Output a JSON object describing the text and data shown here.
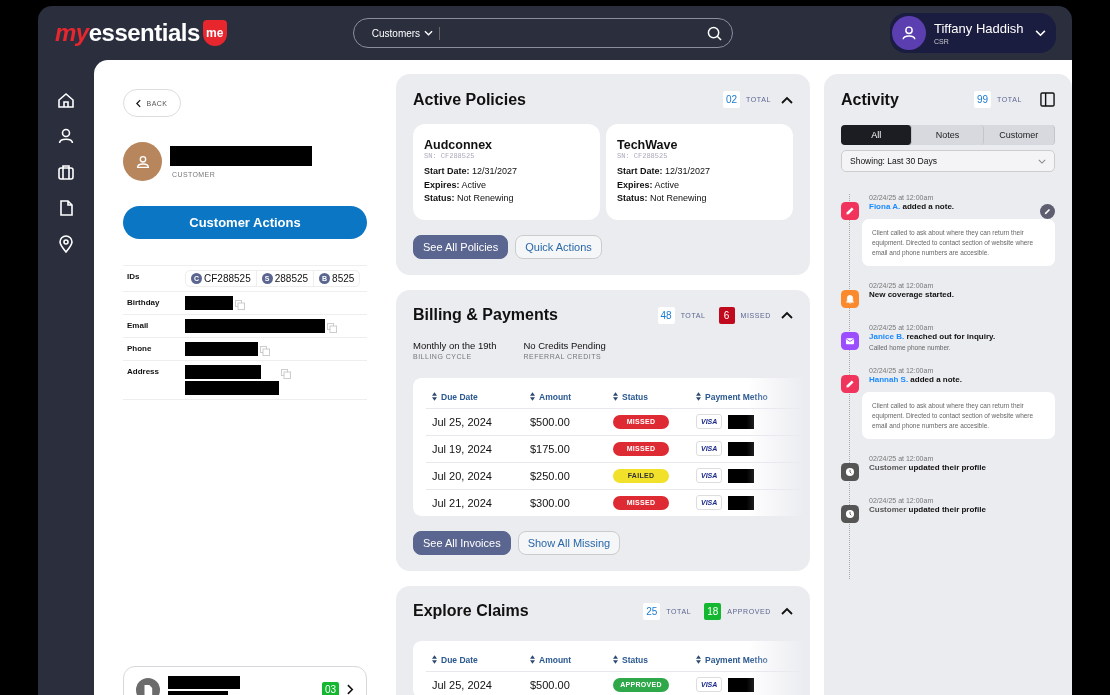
{
  "header": {
    "logo": {
      "first": "my",
      "second": "essentials",
      "badge": "me"
    },
    "search": {
      "scope": "Customers"
    },
    "user": {
      "name": "Tiffany Haddish",
      "role": "CSR"
    }
  },
  "nav": [
    {
      "kind": "home"
    },
    {
      "kind": "user"
    },
    {
      "kind": "briefcase"
    },
    {
      "kind": "file"
    },
    {
      "kind": "pin"
    }
  ],
  "customer": {
    "back": "BACK",
    "role": "CUSTOMER",
    "actions_button": "Customer Actions",
    "ids_label": "IDs",
    "ids": [
      {
        "icon": "C",
        "value": "CF288525"
      },
      {
        "icon": "S",
        "value": "288525"
      },
      {
        "icon": "B",
        "value": "8525"
      }
    ],
    "fields": [
      {
        "label": "Birthday"
      },
      {
        "label": "Email"
      },
      {
        "label": "Phone"
      },
      {
        "label": "Address"
      }
    ],
    "footer_card": {
      "count": "03"
    }
  },
  "policies": {
    "title": "Active Policies",
    "badges": [
      {
        "kind": "total",
        "count": "02",
        "label": "TOTAL"
      }
    ],
    "items": [
      {
        "name": "Audconnex",
        "sn": "SN: CF288525",
        "lines": [
          {
            "key": "Start Date:",
            "value": "12/31/2027"
          },
          {
            "key": "Expires:",
            "value": "Active"
          },
          {
            "key": "Status:",
            "value": "Not Renewing"
          }
        ]
      },
      {
        "name": "TechWave",
        "sn": "SN: CF288525",
        "lines": [
          {
            "key": "Start Date:",
            "value": "12/31/2027"
          },
          {
            "key": "Expires:",
            "value": "Active"
          },
          {
            "key": "Status:",
            "value": "Not Renewing"
          }
        ]
      }
    ],
    "buttons": [
      {
        "label": "See All Policies",
        "kind": "primary"
      },
      {
        "label": "Quick Actions",
        "kind": "outline"
      }
    ]
  },
  "billing": {
    "title": "Billing & Payments",
    "badges": [
      {
        "kind": "total",
        "count": "48",
        "label": "TOTAL"
      },
      {
        "kind": "missed",
        "count": "6",
        "label": "MISSED"
      }
    ],
    "facts": [
      {
        "value": "Monthly on the 19th",
        "label": "BILLING CYCLE"
      },
      {
        "value": "No Credits Pending",
        "label": "REFERRAL CREDITS"
      }
    ],
    "columns": [
      "Due Date",
      "Amount",
      "Status",
      "Payment Metho"
    ],
    "rows": [
      {
        "date": "Jul 25, 2024",
        "amount": "$500.00",
        "status": "MISSED",
        "color": "#dd2a33",
        "card": "VISA"
      },
      {
        "date": "Jul 19, 2024",
        "amount": "$175.00",
        "status": "MISSED",
        "color": "#dd2a33",
        "card": "VISA"
      },
      {
        "date": "Jul 20, 2024",
        "amount": "$250.00",
        "status": "FAILED",
        "color": "#f2e12a",
        "card": "VISA"
      },
      {
        "date": "Jul 21, 2024",
        "amount": "$300.00",
        "status": "MISSED",
        "color": "#dd2a33",
        "card": "VISA"
      }
    ],
    "buttons": [
      {
        "label": "See All Invoices",
        "kind": "primary"
      },
      {
        "label": "Show All Missing",
        "kind": "outline"
      }
    ]
  },
  "claims": {
    "title": "Explore Claims",
    "badges": [
      {
        "kind": "total",
        "count": "25",
        "label": "TOTAL"
      },
      {
        "kind": "approved",
        "count": "18",
        "label": "APPROVED"
      }
    ],
    "columns": [
      "Due Date",
      "Amount",
      "Status",
      "Payment Metho"
    ],
    "rows": [
      {
        "date": "Jul 25, 2024",
        "amount": "$500.00",
        "status": "APPROVED",
        "color": "#2fa84a",
        "card": "VISA"
      }
    ]
  },
  "activity": {
    "title": "Activity",
    "badge": {
      "count": "99",
      "label": "TOTAL"
    },
    "tabs": [
      {
        "label": "All",
        "selected": true
      },
      {
        "label": "Notes",
        "selected": false
      },
      {
        "label": "Customer",
        "selected": false
      }
    ],
    "filter": "Showing: Last 30 Days",
    "items": [
      {
        "kind": "note",
        "time": "02/24/25 at 12:00am",
        "actor": "Fiona A.",
        "actor_link": true,
        "action": "added a note.",
        "editable": true,
        "note": "Client called to ask about where they can return their equipment. Directed to contact section of website where email and phone numbers are accesible."
      },
      {
        "kind": "alert",
        "time": "02/24/25 at 12:00am",
        "action": "New coverage started.",
        "editable": false
      },
      {
        "kind": "message",
        "time": "02/24/25 at 12:00am",
        "actor": "Janice B.",
        "actor_link": true,
        "action": "reached out for inquiry.",
        "detail": "Called home phone number.",
        "editable": false
      },
      {
        "kind": "note",
        "time": "02/24/25 at 12:00am",
        "actor": "Hannah S.",
        "actor_link": true,
        "action": "added a note.",
        "editable": false,
        "note": "Client called to ask about where they can return their equipment. Directed to contact section of website where email and phone numbers are accesible."
      },
      {
        "kind": "profile",
        "time": "02/24/25 at 12:00am",
        "actor": "Customer",
        "actor_link": false,
        "action": "updated their profile",
        "editable": false
      },
      {
        "kind": "profile",
        "time": "02/24/25 at 12:00am",
        "actor": "Customer",
        "actor_link": false,
        "action": "updated their profile",
        "editable": false
      }
    ]
  }
}
